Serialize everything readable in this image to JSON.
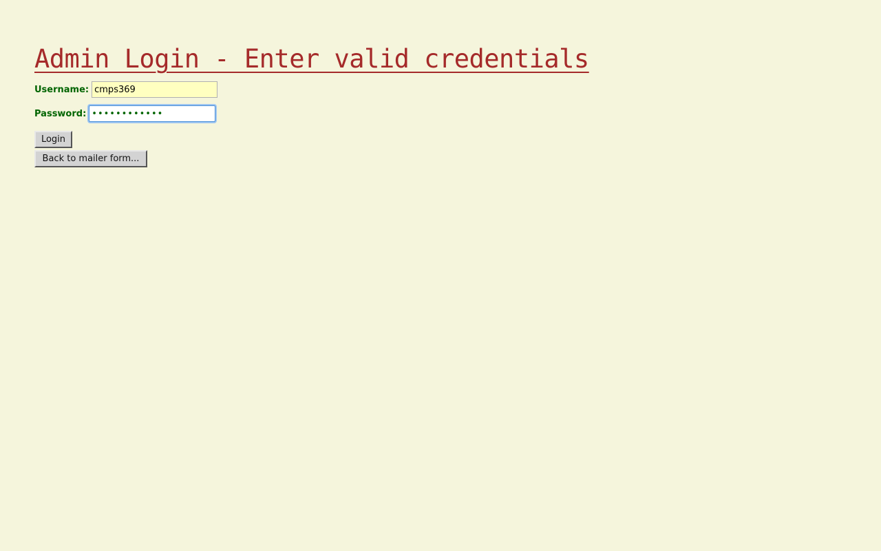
{
  "page": {
    "title": "Admin Login - Enter valid credentials"
  },
  "form": {
    "username_label": "Username:",
    "username_value": "cmps369",
    "password_label": "Password:",
    "password_value": "••••••••••••",
    "login_label": "Login",
    "back_label": "Back to mailer form..."
  },
  "colors": {
    "background": "#f5f5dc",
    "title": "#a52a2a",
    "label": "#006400",
    "username_field_bg": "#ffffc0",
    "focus_ring": "#4a90d9"
  }
}
